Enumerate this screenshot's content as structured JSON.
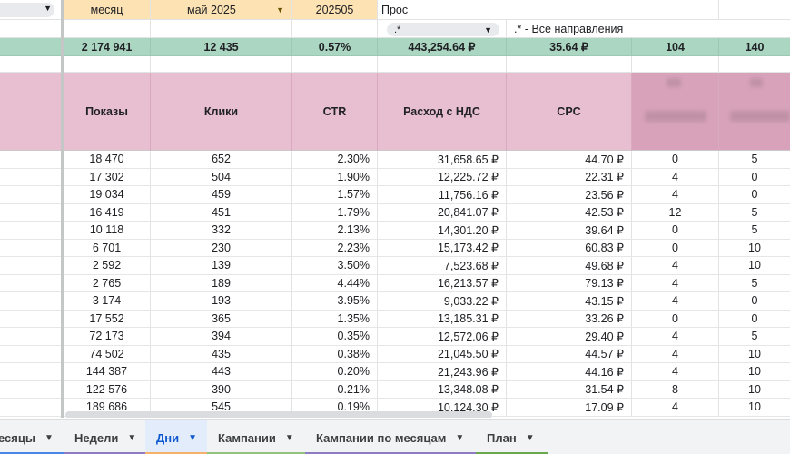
{
  "header_row1": {
    "month_label": "месяц",
    "month_value": "май 2025",
    "month_code": "202505",
    "truncated_text": "Прос"
  },
  "header_row2": {
    "filter_value": ".*",
    "filter_note": ".* - Все направления"
  },
  "totals": [
    "2 174 941",
    "12 435",
    "0.57%",
    "443,254.64 ₽",
    "35.64 ₽",
    "104",
    "140"
  ],
  "columns": [
    "Показы",
    "Клики",
    "CTR",
    "Расход с НДС",
    "CPC",
    "",
    ""
  ],
  "rows": [
    [
      "18 470",
      "652",
      "2.30%",
      "31,658.65 ₽",
      "44.70 ₽",
      "0",
      "5"
    ],
    [
      "17 302",
      "504",
      "1.90%",
      "12,225.72 ₽",
      "22.31 ₽",
      "4",
      "0"
    ],
    [
      "19 034",
      "459",
      "1.57%",
      "11,756.16 ₽",
      "23.56 ₽",
      "4",
      "0"
    ],
    [
      "16 419",
      "451",
      "1.79%",
      "20,841.07 ₽",
      "42.53 ₽",
      "12",
      "5"
    ],
    [
      "10 118",
      "332",
      "2.13%",
      "14,301.20 ₽",
      "39.64 ₽",
      "0",
      "5"
    ],
    [
      "6 701",
      "230",
      "2.23%",
      "15,173.42 ₽",
      "60.83 ₽",
      "0",
      "10"
    ],
    [
      "2 592",
      "139",
      "3.50%",
      "7,523.68 ₽",
      "49.68 ₽",
      "4",
      "10"
    ],
    [
      "2 765",
      "189",
      "4.44%",
      "16,213.57 ₽",
      "79.13 ₽",
      "4",
      "5"
    ],
    [
      "3 174",
      "193",
      "3.95%",
      "9,033.22 ₽",
      "43.15 ₽",
      "4",
      "0"
    ],
    [
      "17 552",
      "365",
      "1.35%",
      "13,185.31 ₽",
      "33.26 ₽",
      "0",
      "0"
    ],
    [
      "72 173",
      "394",
      "0.35%",
      "12,572.06 ₽",
      "29.40 ₽",
      "4",
      "5"
    ],
    [
      "74 502",
      "435",
      "0.38%",
      "21,045.50 ₽",
      "44.57 ₽",
      "4",
      "10"
    ],
    [
      "144 387",
      "443",
      "0.20%",
      "21,243.96 ₽",
      "44.16 ₽",
      "4",
      "10"
    ],
    [
      "122 576",
      "390",
      "0.21%",
      "13,348.08 ₽",
      "31.54 ₽",
      "8",
      "10"
    ],
    [
      "189 686",
      "545",
      "0.19%",
      "10,124.30 ₽",
      "17.09 ₽",
      "4",
      "10"
    ]
  ],
  "tabs": [
    {
      "label": "есяцы",
      "underline": "#4a86e8",
      "active": false
    },
    {
      "label": "Недели",
      "underline": "#8e7cc3",
      "active": false
    },
    {
      "label": "Дни",
      "underline": "#f6b26b",
      "active": true
    },
    {
      "label": "Кампании",
      "underline": "#93c47d",
      "active": false
    },
    {
      "label": "Кампании по месяцам",
      "underline": "#8e7cc3",
      "active": false
    },
    {
      "label": "План",
      "underline": "#6aa84f",
      "active": false
    }
  ],
  "colors": {
    "totals_bg": "#abd6c2",
    "header_bg": "#e8bfd1",
    "input_bg": "#fde3b4",
    "active_tab": "#0b57d0"
  }
}
